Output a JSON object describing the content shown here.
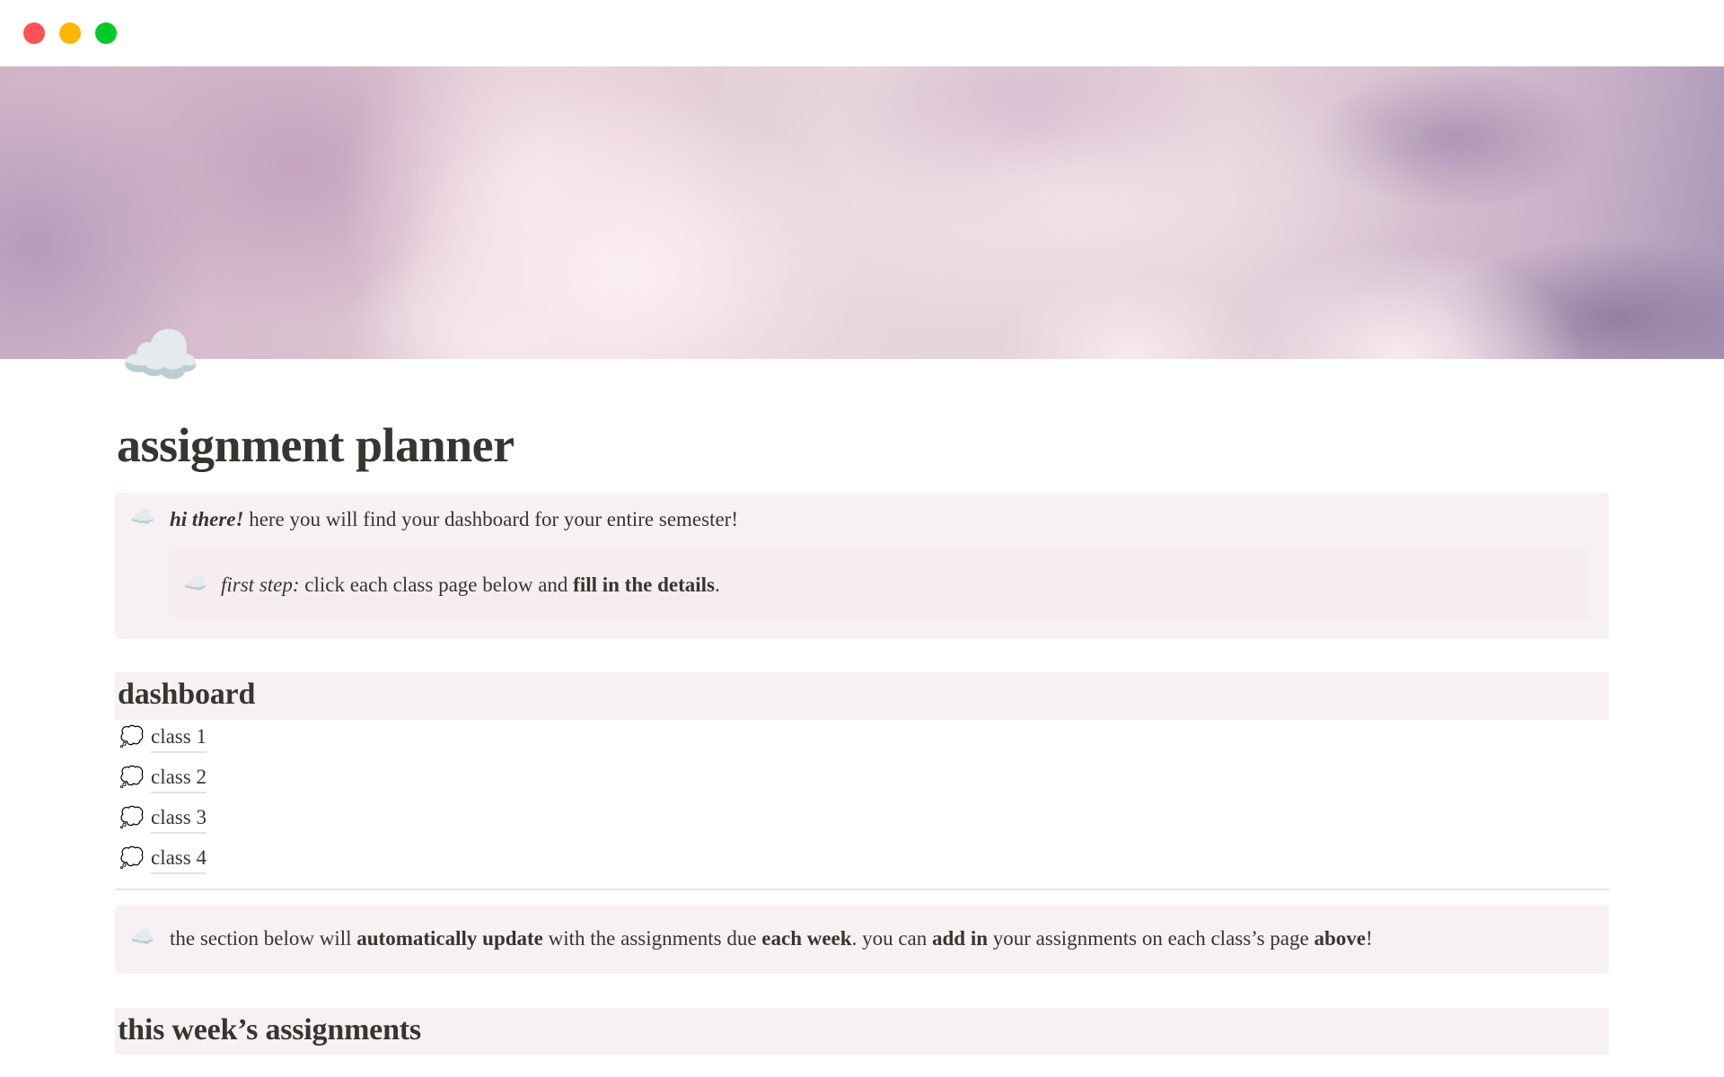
{
  "window": {
    "controls": [
      {
        "name": "close",
        "color": "#ff5257"
      },
      {
        "name": "minimize",
        "color": "#ffb600"
      },
      {
        "name": "zoom",
        "color": "#00c92a"
      }
    ]
  },
  "page": {
    "cover": "pink-purple-clouds-image",
    "icon": "☁️",
    "title": "assignment planner"
  },
  "intro_callout": {
    "icon": "☁️",
    "lead": "hi there!",
    "text": " here you will find your dashboard for your entire semester!",
    "nested": {
      "icon": "☁️",
      "lead": "first step:",
      "text_before": " click each class page below and ",
      "bold": "fill in the details",
      "text_after": "."
    }
  },
  "dashboard": {
    "heading": "dashboard",
    "items": [
      {
        "icon": "💭",
        "label": "class 1"
      },
      {
        "icon": "💭",
        "label": "class 2"
      },
      {
        "icon": "💭",
        "label": "class 3"
      },
      {
        "icon": "💭",
        "label": "class 4"
      }
    ]
  },
  "note_callout": {
    "icon": "☁️",
    "parts": [
      {
        "t": "the section below will ",
        "b": false
      },
      {
        "t": "automatically update",
        "b": true
      },
      {
        "t": " with the assignments due ",
        "b": false
      },
      {
        "t": "each week",
        "b": true
      },
      {
        "t": ". you can ",
        "b": false
      },
      {
        "t": "add in",
        "b": true
      },
      {
        "t": " your assignments on each class’s page ",
        "b": false
      },
      {
        "t": "above",
        "b": true
      },
      {
        "t": "!",
        "b": false
      }
    ]
  },
  "weekly": {
    "heading": "this week’s assignments"
  },
  "colors": {
    "text": "#37352f",
    "callout_bg": "#f7f1f3",
    "nested_callout_bg": "#f6edf1",
    "heading_bg": "#f7f1f3",
    "divider": "#e6e4e2"
  }
}
